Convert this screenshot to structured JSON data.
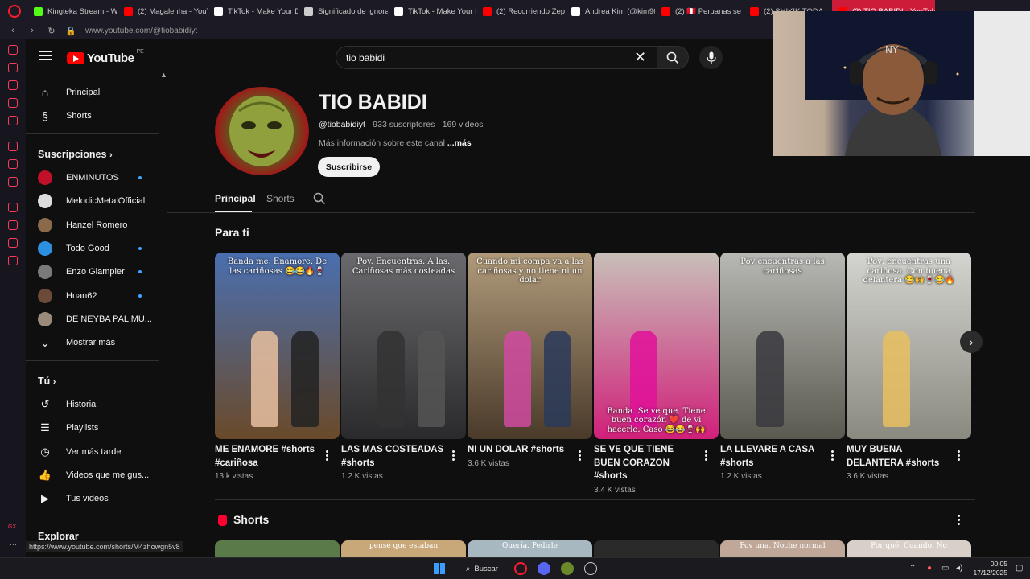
{
  "browser": {
    "tabs": [
      {
        "label": "Kingteka Stream - Wa",
        "icon": "kick-icon",
        "color": "#53fc18"
      },
      {
        "label": "(2) Magalenha - YouT",
        "icon": "youtube-icon",
        "color": "#ff0000"
      },
      {
        "label": "TikTok - Make Your D",
        "icon": "tiktok-icon",
        "color": "#ffffff"
      },
      {
        "label": "Significado de ignora",
        "icon": "globe-icon",
        "color": "#cccccc"
      },
      {
        "label": "TikTok - Make Your D",
        "icon": "tiktok-icon",
        "color": "#ffffff"
      },
      {
        "label": "(2) Recorriendo Zepi",
        "icon": "youtube-icon",
        "color": "#ff0000"
      },
      {
        "label": "Andrea Kim (@kim96",
        "icon": "tiktok-icon",
        "color": "#ffffff"
      },
      {
        "label": "(2) 🇵🇪 Peruanas se Q",
        "icon": "youtube-icon",
        "color": "#ff0000"
      },
      {
        "label": "(2) SHIKIK TODA L",
        "icon": "youtube-icon",
        "color": "#ff0000"
      },
      {
        "label": "(2) TIO BABIDI - YouTube",
        "icon": "youtube-icon",
        "color": "#ff0000",
        "active": true
      }
    ],
    "url": "www.youtube.com/@tiobabidiyt",
    "status_url": "https://www.youtube.com/shorts/M4zhowgn5v8"
  },
  "header": {
    "logo_text": "YouTube",
    "country_code": "PE",
    "search_value": "tio babidi"
  },
  "sidebar": {
    "main": [
      {
        "label": "Principal",
        "icon": "home-icon"
      },
      {
        "label": "Shorts",
        "icon": "shorts-icon"
      }
    ],
    "subscriptions_heading": "Suscripciones",
    "subscriptions": [
      {
        "label": "ENMINUTOS",
        "new": true,
        "color": "#c0102a"
      },
      {
        "label": "MelodicMetalOfficial",
        "new": false,
        "color": "#dddddd"
      },
      {
        "label": "Hanzel Romero",
        "new": false,
        "color": "#8a6a4a"
      },
      {
        "label": "Todo Good",
        "new": true,
        "color": "#2d8fe0"
      },
      {
        "label": "Enzo Giampier",
        "new": true,
        "color": "#7a7a7a"
      },
      {
        "label": "Huan62",
        "new": true,
        "color": "#6b4a3a"
      },
      {
        "label": "DE NEYBA PAL MU...",
        "new": false,
        "color": "#9a8a7a"
      }
    ],
    "show_more": "Mostrar más",
    "you_heading": "Tú",
    "you_items": [
      {
        "label": "Historial",
        "icon": "history-icon"
      },
      {
        "label": "Playlists",
        "icon": "playlists-icon"
      },
      {
        "label": "Ver más tarde",
        "icon": "clock-icon"
      },
      {
        "label": "Videos que me gus...",
        "icon": "thumbs-up-icon"
      },
      {
        "label": "Tus videos",
        "icon": "video-icon"
      }
    ],
    "explore_heading": "Explorar"
  },
  "channel": {
    "name": "TIO BABIDI",
    "handle": "@tiobabidiyt",
    "subscribers": "933 suscriptores",
    "videos": "169 videos",
    "description": "Más información sobre este canal",
    "more": "...más",
    "subscribe_label": "Suscribirse",
    "tabs": [
      "Principal",
      "Shorts"
    ]
  },
  "for_you": {
    "title": "Para ti",
    "videos": [
      {
        "title": "ME ENAMORE #shorts #cariñosa",
        "views": "13 k vistas",
        "caption": "Banda me. Enamore. De las cariñosas 😂😂🔥🍷",
        "bg1": "#4a6fb0",
        "bg2": "#6a4a2a",
        "caption_pos": "top"
      },
      {
        "title": "LAS MAS COSTEADAS #shorts",
        "views": "1.2 K vistas",
        "caption": "Pov. Encuentras. A las. Cariñosas más costeadas",
        "bg1": "#6a6a6e",
        "bg2": "#2a2a2c",
        "caption_pos": "top"
      },
      {
        "title": "NI UN DOLAR #shorts",
        "views": "3.6 K vistas",
        "caption": "Cuando mi compa va a las cariñosas y no tiene ni un dolar",
        "bg1": "#b09a7a",
        "bg2": "#4a3a2a",
        "caption_pos": "top"
      },
      {
        "title": "SE VE QUE TIENE BUEN CORAZON #shorts",
        "views": "3.4 K vistas",
        "caption": "Banda. Se ve que. Tiene buen corazón ❤️ de vi hacerle. Caso 😂😂🍷🙌",
        "bg1": "#c8c0b8",
        "bg2": "#d0207a",
        "caption_pos": "bottom"
      },
      {
        "title": "LA LLEVARE A CASA #shorts",
        "views": "1.2 K vistas",
        "caption": "Pov encuentras a las cariñosas",
        "bg1": "#b8b8b4",
        "bg2": "#5a5a50",
        "caption_pos": "top"
      },
      {
        "title": "MUY BUENA DELANTERA #shorts",
        "views": "3.6 K vistas",
        "caption": "Pov: encuentras una cariñosa. Con buena delantera 😂🙌🍷😂🔥",
        "bg1": "#d4d4d0",
        "bg2": "#8a8a80",
        "caption_pos": "top"
      }
    ]
  },
  "shorts_section": {
    "title": "Shorts",
    "previews": [
      "",
      "pensé que estaban",
      "Quería. Pedirle",
      "",
      "Pov una. Noche normal",
      "Por qué. Cuando. No"
    ]
  },
  "taskbar": {
    "search_label": "Buscar",
    "time": "00:05",
    "date": "17/12/2025"
  }
}
